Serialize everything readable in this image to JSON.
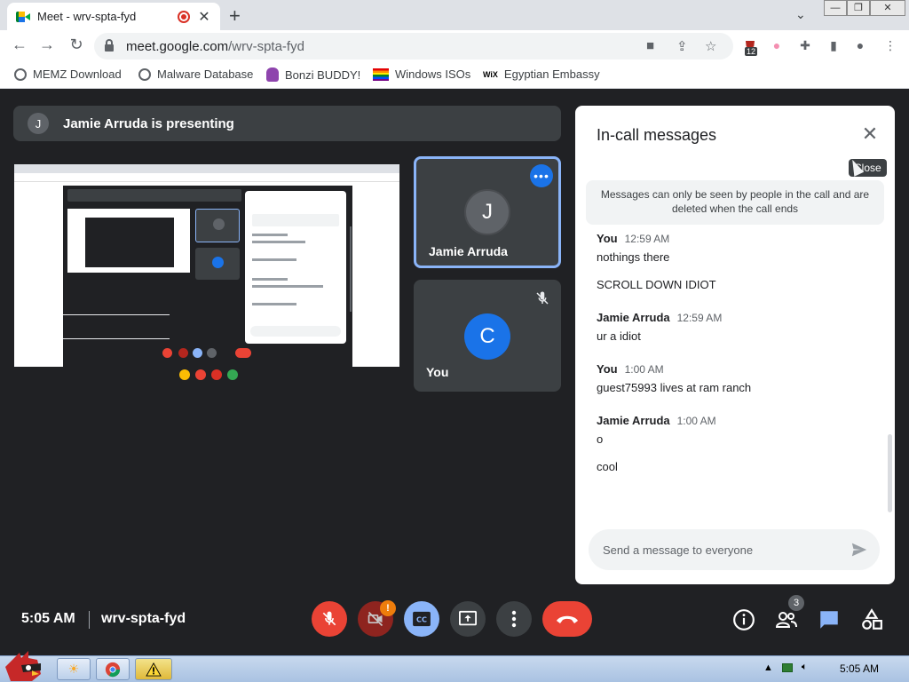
{
  "browser": {
    "tab_title": "Meet - wrv-spta-fyd",
    "url_host": "meet.google.com",
    "url_path": "/wrv-spta-fyd",
    "extension_badge": "12"
  },
  "bookmarks": [
    {
      "label": "MEMZ Download",
      "icon": "globe-icon"
    },
    {
      "label": "Malware Database",
      "icon": "globe-icon"
    },
    {
      "label": "Bonzi BUDDY!",
      "icon": "bonzi-icon"
    },
    {
      "label": "Windows ISOs",
      "icon": "rainbow-flag-icon"
    },
    {
      "label": "Egyptian Embassy",
      "icon": "wix-icon"
    }
  ],
  "meet": {
    "presenter_initial": "J",
    "presenting_text": "Jamie Arruda is presenting",
    "tiles": [
      {
        "name": "Jamie Arruda",
        "initial": "J",
        "avatar_color": "#5f6368"
      },
      {
        "name": "You",
        "initial": "C",
        "avatar_color": "#1a73e8"
      }
    ],
    "time": "5:05 AM",
    "meeting_code": "wrv-spta-fyd",
    "camera_warning_badge": "!",
    "people_count": "3"
  },
  "chat": {
    "title": "In-call messages",
    "close_tooltip": "Close",
    "notice": "Messages can only be seen by people in the call and are deleted when the call ends",
    "groups": [
      {
        "sender": "You",
        "time": "12:59 AM",
        "lines": [
          "nothings there",
          "SCROLL DOWN IDIOT"
        ]
      },
      {
        "sender": "Jamie Arruda",
        "time": "12:59 AM",
        "lines": [
          "ur a idiot"
        ]
      },
      {
        "sender": "You",
        "time": "1:00 AM",
        "lines": [
          "guest75993 lives at ram ranch"
        ]
      },
      {
        "sender": "Jamie Arruda",
        "time": "1:00 AM",
        "lines": [
          "o",
          "cool"
        ]
      }
    ],
    "input_placeholder": "Send a message to everyone"
  },
  "taskbar": {
    "clock": "5:05 AM"
  },
  "colors": {
    "meet_bg": "#202124",
    "accent_blue": "#1a73e8",
    "end_call_red": "#ea4335"
  }
}
